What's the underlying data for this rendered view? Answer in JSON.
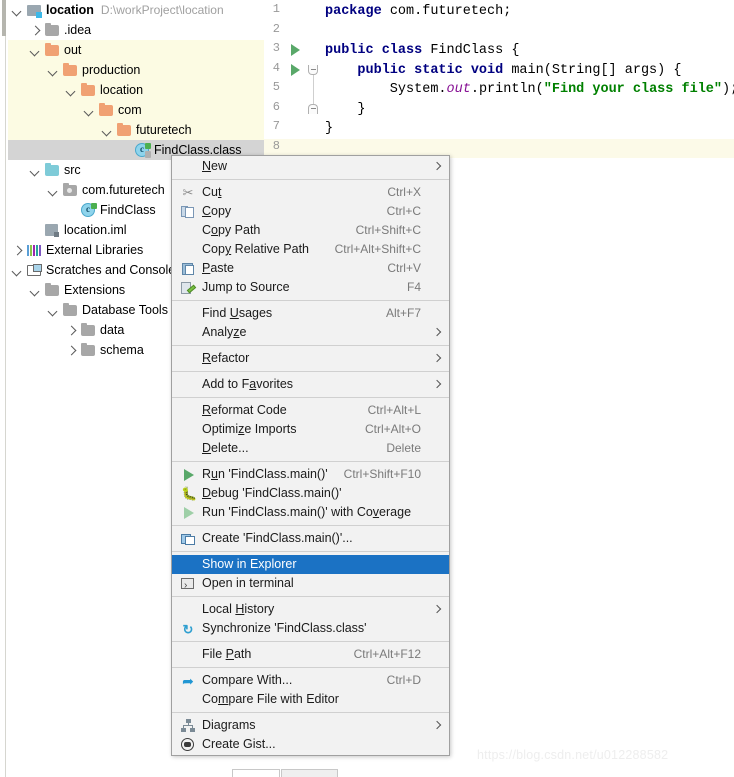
{
  "project_tree": {
    "root_label": "location",
    "root_path": "D:\\workProject\\location",
    "items": [
      {
        "label": "location",
        "path": "D:\\workProject\\location",
        "icon": "module-icon",
        "arrow": "down",
        "indent": 0,
        "bold": true,
        "highlight": "none"
      },
      {
        "label": ".idea",
        "icon": "folder-grey-icon",
        "arrow": "right",
        "indent": 1,
        "bold": false,
        "highlight": "none"
      },
      {
        "label": "out",
        "icon": "folder-orange-icon",
        "arrow": "down",
        "indent": 1,
        "bold": false,
        "highlight": "yellow"
      },
      {
        "label": "production",
        "icon": "folder-orange-icon",
        "arrow": "down",
        "indent": 2,
        "bold": false,
        "highlight": "yellow"
      },
      {
        "label": "location",
        "icon": "folder-orange-icon",
        "arrow": "down",
        "indent": 3,
        "bold": false,
        "highlight": "yellow"
      },
      {
        "label": "com",
        "icon": "folder-orange-icon",
        "arrow": "down",
        "indent": 4,
        "bold": false,
        "highlight": "yellow"
      },
      {
        "label": "futuretech",
        "icon": "folder-orange-icon",
        "arrow": "down",
        "indent": 5,
        "bold": false,
        "highlight": "yellow"
      },
      {
        "label": "FindClass.class",
        "icon": "class-file-icon",
        "arrow": "none",
        "indent": 6,
        "bold": false,
        "highlight": "grey"
      },
      {
        "label": "src",
        "icon": "folder-cyan-icon",
        "arrow": "down",
        "indent": 1,
        "bold": false,
        "highlight": "none"
      },
      {
        "label": "com.futuretech",
        "icon": "package-icon",
        "arrow": "down",
        "indent": 2,
        "bold": false,
        "highlight": "none"
      },
      {
        "label": "FindClass",
        "icon": "class-icon",
        "arrow": "none",
        "indent": 3,
        "bold": false,
        "highlight": "none"
      },
      {
        "label": "location.iml",
        "icon": "iml-file-icon",
        "arrow": "none",
        "indent": 1,
        "bold": false,
        "highlight": "none"
      },
      {
        "label": "External Libraries",
        "icon": "external-libraries-icon",
        "arrow": "right",
        "indent": 0,
        "bold": false,
        "highlight": "none"
      },
      {
        "label": "Scratches and Consoles",
        "icon": "scratches-icon",
        "arrow": "down",
        "indent": 0,
        "bold": false,
        "highlight": "none"
      },
      {
        "label": "Extensions",
        "icon": "folder-grey-icon",
        "arrow": "down",
        "indent": 1,
        "bold": false,
        "highlight": "none"
      },
      {
        "label": "Database Tools and SQL",
        "icon": "folder-grey-icon",
        "arrow": "down",
        "indent": 2,
        "bold": false,
        "highlight": "none"
      },
      {
        "label": "data",
        "icon": "folder-grey-icon",
        "arrow": "right",
        "indent": 3,
        "bold": false,
        "highlight": "none"
      },
      {
        "label": "schema",
        "icon": "folder-grey-icon",
        "arrow": "right",
        "indent": 3,
        "bold": false,
        "highlight": "none"
      }
    ]
  },
  "editor": {
    "line_numbers": [
      "1",
      "2",
      "3",
      "4",
      "5",
      "6",
      "7",
      "8"
    ],
    "current_line": 8,
    "run_markers": [
      3,
      4
    ],
    "lines": [
      {
        "n": 1,
        "tokens": [
          {
            "t": "package",
            "c": "kw"
          },
          {
            "t": " com.futuretech;",
            "c": ""
          }
        ]
      },
      {
        "n": 2,
        "tokens": [
          {
            "t": "",
            "c": ""
          }
        ]
      },
      {
        "n": 3,
        "tokens": [
          {
            "t": "public class",
            "c": "kw"
          },
          {
            "t": " FindClass {",
            "c": ""
          }
        ]
      },
      {
        "n": 4,
        "tokens": [
          {
            "t": "    ",
            "c": ""
          },
          {
            "t": "public static void",
            "c": "kw"
          },
          {
            "t": " main(String[] args) {",
            "c": ""
          }
        ]
      },
      {
        "n": 5,
        "tokens": [
          {
            "t": "        System.",
            "c": ""
          },
          {
            "t": "out",
            "c": "fld"
          },
          {
            "t": ".println(",
            "c": ""
          },
          {
            "t": "\"Find your class file\"",
            "c": "str"
          },
          {
            "t": ");",
            "c": ""
          }
        ]
      },
      {
        "n": 6,
        "tokens": [
          {
            "t": "    }",
            "c": ""
          }
        ]
      },
      {
        "n": 7,
        "tokens": [
          {
            "t": "}",
            "c": ""
          }
        ]
      },
      {
        "n": 8,
        "tokens": [
          {
            "t": "",
            "c": ""
          }
        ]
      }
    ]
  },
  "context_menu": {
    "selected_item": "Show in Explorer",
    "groups": [
      {
        "items": [
          {
            "label": "New",
            "mnemonic": "N",
            "shortcut": "",
            "icon": "",
            "submenu": true
          }
        ]
      },
      {
        "items": [
          {
            "label": "Cut",
            "mnemonic": "t",
            "shortcut": "Ctrl+X",
            "icon": "cut-icon",
            "submenu": false
          },
          {
            "label": "Copy",
            "mnemonic": "C",
            "shortcut": "Ctrl+C",
            "icon": "copy-icon",
            "submenu": false
          },
          {
            "label": "Copy Path",
            "mnemonic": "o",
            "shortcut": "Ctrl+Shift+C",
            "icon": "",
            "submenu": false
          },
          {
            "label": "Copy Relative Path",
            "mnemonic": "y",
            "shortcut": "Ctrl+Alt+Shift+C",
            "icon": "",
            "submenu": false
          },
          {
            "label": "Paste",
            "mnemonic": "P",
            "shortcut": "Ctrl+V",
            "icon": "paste-icon",
            "submenu": false
          },
          {
            "label": "Jump to Source",
            "mnemonic": "",
            "shortcut": "F4",
            "icon": "jump-to-source-icon",
            "submenu": false
          }
        ]
      },
      {
        "items": [
          {
            "label": "Find Usages",
            "mnemonic": "U",
            "shortcut": "Alt+F7",
            "icon": "",
            "submenu": false
          },
          {
            "label": "Analyze",
            "mnemonic": "z",
            "shortcut": "",
            "icon": "",
            "submenu": true
          }
        ]
      },
      {
        "items": [
          {
            "label": "Refactor",
            "mnemonic": "R",
            "shortcut": "",
            "icon": "",
            "submenu": true
          }
        ]
      },
      {
        "items": [
          {
            "label": "Add to Favorites",
            "mnemonic": "a",
            "shortcut": "",
            "icon": "",
            "submenu": true
          }
        ]
      },
      {
        "items": [
          {
            "label": "Reformat Code",
            "mnemonic": "R",
            "shortcut": "Ctrl+Alt+L",
            "icon": "",
            "submenu": false
          },
          {
            "label": "Optimize Imports",
            "mnemonic": "z",
            "shortcut": "Ctrl+Alt+O",
            "icon": "",
            "submenu": false
          },
          {
            "label": "Delete...",
            "mnemonic": "D",
            "shortcut": "Delete",
            "icon": "",
            "submenu": false
          }
        ]
      },
      {
        "items": [
          {
            "label": "Run 'FindClass.main()'",
            "mnemonic": "u",
            "shortcut": "Ctrl+Shift+F10",
            "icon": "run-icon",
            "submenu": false
          },
          {
            "label": "Debug 'FindClass.main()'",
            "mnemonic": "D",
            "shortcut": "",
            "icon": "debug-icon",
            "submenu": false
          },
          {
            "label": "Run 'FindClass.main()' with Coverage",
            "mnemonic": "v",
            "shortcut": "",
            "icon": "coverage-icon",
            "submenu": false
          }
        ]
      },
      {
        "items": [
          {
            "label": "Create 'FindClass.main()'...",
            "mnemonic": "",
            "shortcut": "",
            "icon": "create-config-icon",
            "submenu": false
          }
        ]
      },
      {
        "items": [
          {
            "label": "Show in Explorer",
            "mnemonic": "",
            "shortcut": "",
            "icon": "",
            "submenu": false
          },
          {
            "label": "Open in terminal",
            "mnemonic": "",
            "shortcut": "",
            "icon": "terminal-icon",
            "submenu": false
          }
        ]
      },
      {
        "items": [
          {
            "label": "Local History",
            "mnemonic": "H",
            "shortcut": "",
            "icon": "",
            "submenu": true
          },
          {
            "label": "Synchronize 'FindClass.class'",
            "mnemonic": "",
            "shortcut": "",
            "icon": "synchronize-icon",
            "submenu": false
          }
        ]
      },
      {
        "items": [
          {
            "label": "File Path",
            "mnemonic": "P",
            "shortcut": "Ctrl+Alt+F12",
            "icon": "",
            "submenu": false
          }
        ]
      },
      {
        "items": [
          {
            "label": "Compare With...",
            "mnemonic": "",
            "shortcut": "Ctrl+D",
            "icon": "compare-icon",
            "submenu": false
          },
          {
            "label": "Compare File with Editor",
            "mnemonic": "m",
            "shortcut": "",
            "icon": "",
            "submenu": false
          }
        ]
      },
      {
        "items": [
          {
            "label": "Diagrams",
            "mnemonic": "",
            "shortcut": "",
            "icon": "diagrams-icon",
            "submenu": true
          },
          {
            "label": "Create Gist...",
            "mnemonic": "",
            "shortcut": "",
            "icon": "gist-icon",
            "submenu": false
          }
        ]
      }
    ]
  },
  "watermark": {
    "text": "https://blog.csdn.net/u012288582"
  },
  "colors": {
    "selection_blue": "#1b72c4",
    "tree_highlight_yellow": "#fcfbe3",
    "tree_selected_grey": "#d4d4d4",
    "keyword_blue": "#000080",
    "string_green": "#008000",
    "field_purple": "#871094",
    "run_green": "#59a869"
  }
}
